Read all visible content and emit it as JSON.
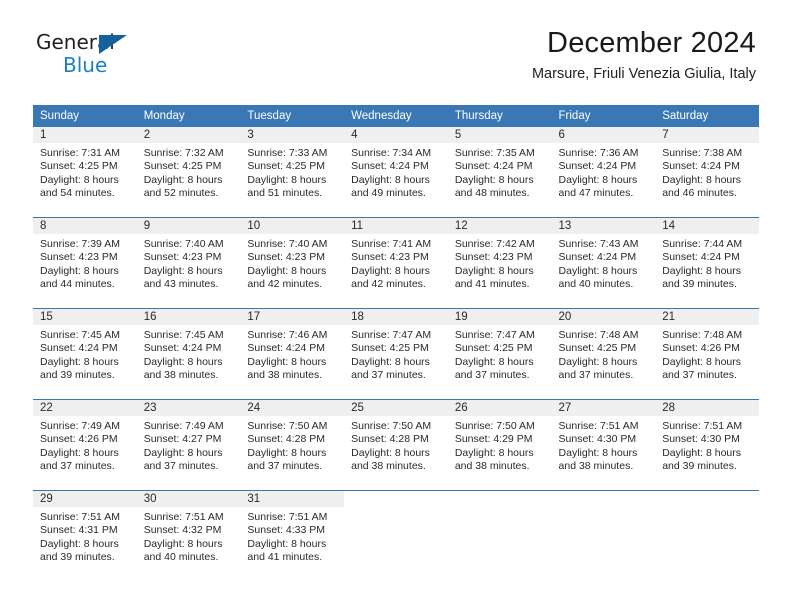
{
  "brand": {
    "line1": "General",
    "line2": "Blue",
    "triangle_color": "#15619e",
    "blue_text_color": "#1b7fc4"
  },
  "header": {
    "month_title": "December 2024",
    "location": "Marsure, Friuli Venezia Giulia, Italy"
  },
  "theme": {
    "header_blue": "#3a78b5",
    "daynum_band": "#efefef",
    "text": "#2a2a2a"
  },
  "weekday_headers": [
    "Sunday",
    "Monday",
    "Tuesday",
    "Wednesday",
    "Thursday",
    "Friday",
    "Saturday"
  ],
  "labels": {
    "sunrise_prefix": "Sunrise:",
    "sunset_prefix": "Sunset:",
    "daylight_prefix": "Daylight:"
  },
  "weeks": [
    [
      {
        "day": "1",
        "sunrise": "Sunrise: 7:31 AM",
        "sunset": "Sunset: 4:25 PM",
        "daylight_1": "Daylight: 8 hours",
        "daylight_2": "and 54 minutes."
      },
      {
        "day": "2",
        "sunrise": "Sunrise: 7:32 AM",
        "sunset": "Sunset: 4:25 PM",
        "daylight_1": "Daylight: 8 hours",
        "daylight_2": "and 52 minutes."
      },
      {
        "day": "3",
        "sunrise": "Sunrise: 7:33 AM",
        "sunset": "Sunset: 4:25 PM",
        "daylight_1": "Daylight: 8 hours",
        "daylight_2": "and 51 minutes."
      },
      {
        "day": "4",
        "sunrise": "Sunrise: 7:34 AM",
        "sunset": "Sunset: 4:24 PM",
        "daylight_1": "Daylight: 8 hours",
        "daylight_2": "and 49 minutes."
      },
      {
        "day": "5",
        "sunrise": "Sunrise: 7:35 AM",
        "sunset": "Sunset: 4:24 PM",
        "daylight_1": "Daylight: 8 hours",
        "daylight_2": "and 48 minutes."
      },
      {
        "day": "6",
        "sunrise": "Sunrise: 7:36 AM",
        "sunset": "Sunset: 4:24 PM",
        "daylight_1": "Daylight: 8 hours",
        "daylight_2": "and 47 minutes."
      },
      {
        "day": "7",
        "sunrise": "Sunrise: 7:38 AM",
        "sunset": "Sunset: 4:24 PM",
        "daylight_1": "Daylight: 8 hours",
        "daylight_2": "and 46 minutes."
      }
    ],
    [
      {
        "day": "8",
        "sunrise": "Sunrise: 7:39 AM",
        "sunset": "Sunset: 4:23 PM",
        "daylight_1": "Daylight: 8 hours",
        "daylight_2": "and 44 minutes."
      },
      {
        "day": "9",
        "sunrise": "Sunrise: 7:40 AM",
        "sunset": "Sunset: 4:23 PM",
        "daylight_1": "Daylight: 8 hours",
        "daylight_2": "and 43 minutes."
      },
      {
        "day": "10",
        "sunrise": "Sunrise: 7:40 AM",
        "sunset": "Sunset: 4:23 PM",
        "daylight_1": "Daylight: 8 hours",
        "daylight_2": "and 42 minutes."
      },
      {
        "day": "11",
        "sunrise": "Sunrise: 7:41 AM",
        "sunset": "Sunset: 4:23 PM",
        "daylight_1": "Daylight: 8 hours",
        "daylight_2": "and 42 minutes."
      },
      {
        "day": "12",
        "sunrise": "Sunrise: 7:42 AM",
        "sunset": "Sunset: 4:23 PM",
        "daylight_1": "Daylight: 8 hours",
        "daylight_2": "and 41 minutes."
      },
      {
        "day": "13",
        "sunrise": "Sunrise: 7:43 AM",
        "sunset": "Sunset: 4:24 PM",
        "daylight_1": "Daylight: 8 hours",
        "daylight_2": "and 40 minutes."
      },
      {
        "day": "14",
        "sunrise": "Sunrise: 7:44 AM",
        "sunset": "Sunset: 4:24 PM",
        "daylight_1": "Daylight: 8 hours",
        "daylight_2": "and 39 minutes."
      }
    ],
    [
      {
        "day": "15",
        "sunrise": "Sunrise: 7:45 AM",
        "sunset": "Sunset: 4:24 PM",
        "daylight_1": "Daylight: 8 hours",
        "daylight_2": "and 39 minutes."
      },
      {
        "day": "16",
        "sunrise": "Sunrise: 7:45 AM",
        "sunset": "Sunset: 4:24 PM",
        "daylight_1": "Daylight: 8 hours",
        "daylight_2": "and 38 minutes."
      },
      {
        "day": "17",
        "sunrise": "Sunrise: 7:46 AM",
        "sunset": "Sunset: 4:24 PM",
        "daylight_1": "Daylight: 8 hours",
        "daylight_2": "and 38 minutes."
      },
      {
        "day": "18",
        "sunrise": "Sunrise: 7:47 AM",
        "sunset": "Sunset: 4:25 PM",
        "daylight_1": "Daylight: 8 hours",
        "daylight_2": "and 37 minutes."
      },
      {
        "day": "19",
        "sunrise": "Sunrise: 7:47 AM",
        "sunset": "Sunset: 4:25 PM",
        "daylight_1": "Daylight: 8 hours",
        "daylight_2": "and 37 minutes."
      },
      {
        "day": "20",
        "sunrise": "Sunrise: 7:48 AM",
        "sunset": "Sunset: 4:25 PM",
        "daylight_1": "Daylight: 8 hours",
        "daylight_2": "and 37 minutes."
      },
      {
        "day": "21",
        "sunrise": "Sunrise: 7:48 AM",
        "sunset": "Sunset: 4:26 PM",
        "daylight_1": "Daylight: 8 hours",
        "daylight_2": "and 37 minutes."
      }
    ],
    [
      {
        "day": "22",
        "sunrise": "Sunrise: 7:49 AM",
        "sunset": "Sunset: 4:26 PM",
        "daylight_1": "Daylight: 8 hours",
        "daylight_2": "and 37 minutes."
      },
      {
        "day": "23",
        "sunrise": "Sunrise: 7:49 AM",
        "sunset": "Sunset: 4:27 PM",
        "daylight_1": "Daylight: 8 hours",
        "daylight_2": "and 37 minutes."
      },
      {
        "day": "24",
        "sunrise": "Sunrise: 7:50 AM",
        "sunset": "Sunset: 4:28 PM",
        "daylight_1": "Daylight: 8 hours",
        "daylight_2": "and 37 minutes."
      },
      {
        "day": "25",
        "sunrise": "Sunrise: 7:50 AM",
        "sunset": "Sunset: 4:28 PM",
        "daylight_1": "Daylight: 8 hours",
        "daylight_2": "and 38 minutes."
      },
      {
        "day": "26",
        "sunrise": "Sunrise: 7:50 AM",
        "sunset": "Sunset: 4:29 PM",
        "daylight_1": "Daylight: 8 hours",
        "daylight_2": "and 38 minutes."
      },
      {
        "day": "27",
        "sunrise": "Sunrise: 7:51 AM",
        "sunset": "Sunset: 4:30 PM",
        "daylight_1": "Daylight: 8 hours",
        "daylight_2": "and 38 minutes."
      },
      {
        "day": "28",
        "sunrise": "Sunrise: 7:51 AM",
        "sunset": "Sunset: 4:30 PM",
        "daylight_1": "Daylight: 8 hours",
        "daylight_2": "and 39 minutes."
      }
    ],
    [
      {
        "day": "29",
        "sunrise": "Sunrise: 7:51 AM",
        "sunset": "Sunset: 4:31 PM",
        "daylight_1": "Daylight: 8 hours",
        "daylight_2": "and 39 minutes."
      },
      {
        "day": "30",
        "sunrise": "Sunrise: 7:51 AM",
        "sunset": "Sunset: 4:32 PM",
        "daylight_1": "Daylight: 8 hours",
        "daylight_2": "and 40 minutes."
      },
      {
        "day": "31",
        "sunrise": "Sunrise: 7:51 AM",
        "sunset": "Sunset: 4:33 PM",
        "daylight_1": "Daylight: 8 hours",
        "daylight_2": "and 41 minutes."
      },
      {
        "day": "",
        "sunrise": "",
        "sunset": "",
        "daylight_1": "",
        "daylight_2": ""
      },
      {
        "day": "",
        "sunrise": "",
        "sunset": "",
        "daylight_1": "",
        "daylight_2": ""
      },
      {
        "day": "",
        "sunrise": "",
        "sunset": "",
        "daylight_1": "",
        "daylight_2": ""
      },
      {
        "day": "",
        "sunrise": "",
        "sunset": "",
        "daylight_1": "",
        "daylight_2": ""
      }
    ]
  ]
}
